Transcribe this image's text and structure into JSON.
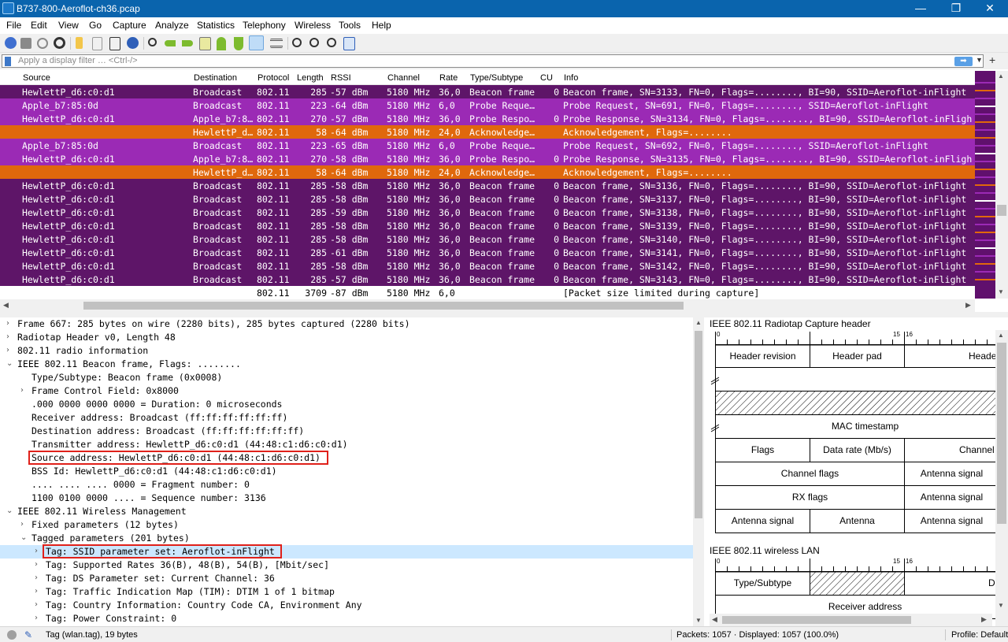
{
  "window": {
    "title": "B737-800-Aeroflot-ch36.pcap",
    "min": "—",
    "restore": "❐",
    "close": "✕"
  },
  "menu": [
    "File",
    "Edit",
    "View",
    "Go",
    "Capture",
    "Analyze",
    "Statistics",
    "Telephony",
    "Wireless",
    "Tools",
    "Help"
  ],
  "filter": {
    "placeholder": "Apply a display filter … <Ctrl-/>",
    "apply_icon": "arrow-right-icon",
    "dropdown": "▼",
    "add": "+"
  },
  "packet_list": {
    "columns": [
      "Source",
      "Destination",
      "Protocol",
      "Length",
      "RSSI",
      "Channel",
      "Rate",
      "Type/Subtype",
      "CU",
      "Info"
    ],
    "colors": {
      "beacon": "#5e1568",
      "probe_req": "#9b2ab5",
      "probe_resp": "#9b2ab5",
      "ack": "#e0680c",
      "limited": "#ffffff",
      "limited_text": "#000000"
    },
    "rows": [
      {
        "kind": "beacon",
        "source": "HewlettP_d6:c0:d1",
        "destination": "Broadcast",
        "protocol": "802.11",
        "length": "285",
        "rssi": "-57 dBm",
        "channel": "5180 MHz",
        "rate": "36,0",
        "type": "Beacon frame",
        "cu": "0",
        "info": "Beacon frame, SN=3133, FN=0, Flags=........, BI=90, SSID=Aeroflot-inFlight"
      },
      {
        "kind": "probe_req",
        "source": "Apple_b7:85:0d",
        "destination": "Broadcast",
        "protocol": "802.11",
        "length": "223",
        "rssi": "-64 dBm",
        "channel": "5180 MHz",
        "rate": "6,0",
        "type": "Probe Reque…",
        "cu": "",
        "info": "Probe Request, SN=691, FN=0, Flags=........, SSID=Aeroflot-inFlight"
      },
      {
        "kind": "probe_resp",
        "source": "HewlettP_d6:c0:d1",
        "destination": "Apple_b7:8…",
        "protocol": "802.11",
        "length": "270",
        "rssi": "-57 dBm",
        "channel": "5180 MHz",
        "rate": "36,0",
        "type": "Probe Respo…",
        "cu": "0",
        "info": "Probe Response, SN=3134, FN=0, Flags=........, BI=90, SSID=Aeroflot-inFlight"
      },
      {
        "kind": "ack",
        "source": "",
        "destination": "HewlettP_d…",
        "protocol": "802.11",
        "length": "58",
        "rssi": "-64 dBm",
        "channel": "5180 MHz",
        "rate": "24,0",
        "type": "Acknowledge…",
        "cu": "",
        "info": "Acknowledgement, Flags=........"
      },
      {
        "kind": "probe_req",
        "source": "Apple_b7:85:0d",
        "destination": "Broadcast",
        "protocol": "802.11",
        "length": "223",
        "rssi": "-65 dBm",
        "channel": "5180 MHz",
        "rate": "6,0",
        "type": "Probe Reque…",
        "cu": "",
        "info": "Probe Request, SN=692, FN=0, Flags=........, SSID=Aeroflot-inFlight"
      },
      {
        "kind": "probe_resp",
        "source": "HewlettP_d6:c0:d1",
        "destination": "Apple_b7:8…",
        "protocol": "802.11",
        "length": "270",
        "rssi": "-58 dBm",
        "channel": "5180 MHz",
        "rate": "36,0",
        "type": "Probe Respo…",
        "cu": "0",
        "info": "Probe Response, SN=3135, FN=0, Flags=........, BI=90, SSID=Aeroflot-inFlight"
      },
      {
        "kind": "ack",
        "source": "",
        "destination": "HewlettP_d…",
        "protocol": "802.11",
        "length": "58",
        "rssi": "-64 dBm",
        "channel": "5180 MHz",
        "rate": "24,0",
        "type": "Acknowledge…",
        "cu": "",
        "info": "Acknowledgement, Flags=........"
      },
      {
        "kind": "beacon",
        "source": "HewlettP_d6:c0:d1",
        "destination": "Broadcast",
        "protocol": "802.11",
        "length": "285",
        "rssi": "-58 dBm",
        "channel": "5180 MHz",
        "rate": "36,0",
        "type": "Beacon frame",
        "cu": "0",
        "info": "Beacon frame, SN=3136, FN=0, Flags=........, BI=90, SSID=Aeroflot-inFlight"
      },
      {
        "kind": "beacon",
        "source": "HewlettP_d6:c0:d1",
        "destination": "Broadcast",
        "protocol": "802.11",
        "length": "285",
        "rssi": "-58 dBm",
        "channel": "5180 MHz",
        "rate": "36,0",
        "type": "Beacon frame",
        "cu": "0",
        "info": "Beacon frame, SN=3137, FN=0, Flags=........, BI=90, SSID=Aeroflot-inFlight"
      },
      {
        "kind": "beacon",
        "source": "HewlettP_d6:c0:d1",
        "destination": "Broadcast",
        "protocol": "802.11",
        "length": "285",
        "rssi": "-59 dBm",
        "channel": "5180 MHz",
        "rate": "36,0",
        "type": "Beacon frame",
        "cu": "0",
        "info": "Beacon frame, SN=3138, FN=0, Flags=........, BI=90, SSID=Aeroflot-inFlight"
      },
      {
        "kind": "beacon",
        "source": "HewlettP_d6:c0:d1",
        "destination": "Broadcast",
        "protocol": "802.11",
        "length": "285",
        "rssi": "-58 dBm",
        "channel": "5180 MHz",
        "rate": "36,0",
        "type": "Beacon frame",
        "cu": "0",
        "info": "Beacon frame, SN=3139, FN=0, Flags=........, BI=90, SSID=Aeroflot-inFlight"
      },
      {
        "kind": "beacon",
        "source": "HewlettP_d6:c0:d1",
        "destination": "Broadcast",
        "protocol": "802.11",
        "length": "285",
        "rssi": "-58 dBm",
        "channel": "5180 MHz",
        "rate": "36,0",
        "type": "Beacon frame",
        "cu": "0",
        "info": "Beacon frame, SN=3140, FN=0, Flags=........, BI=90, SSID=Aeroflot-inFlight"
      },
      {
        "kind": "beacon",
        "source": "HewlettP_d6:c0:d1",
        "destination": "Broadcast",
        "protocol": "802.11",
        "length": "285",
        "rssi": "-61 dBm",
        "channel": "5180 MHz",
        "rate": "36,0",
        "type": "Beacon frame",
        "cu": "0",
        "info": "Beacon frame, SN=3141, FN=0, Flags=........, BI=90, SSID=Aeroflot-inFlight"
      },
      {
        "kind": "beacon",
        "source": "HewlettP_d6:c0:d1",
        "destination": "Broadcast",
        "protocol": "802.11",
        "length": "285",
        "rssi": "-58 dBm",
        "channel": "5180 MHz",
        "rate": "36,0",
        "type": "Beacon frame",
        "cu": "0",
        "info": "Beacon frame, SN=3142, FN=0, Flags=........, BI=90, SSID=Aeroflot-inFlight"
      },
      {
        "kind": "beacon",
        "source": "HewlettP_d6:c0:d1",
        "destination": "Broadcast",
        "protocol": "802.11",
        "length": "285",
        "rssi": "-57 dBm",
        "channel": "5180 MHz",
        "rate": "36,0",
        "type": "Beacon frame",
        "cu": "0",
        "info": "Beacon frame, SN=3143, FN=0, Flags=........, BI=90, SSID=Aeroflot-inFlight"
      },
      {
        "kind": "limited",
        "source": "",
        "destination": "",
        "protocol": "802.11",
        "length": "3709",
        "rssi": "-87 dBm",
        "channel": "5180 MHz",
        "rate": "6,0",
        "type": "",
        "cu": "",
        "info": "[Packet size limited during capture]"
      }
    ]
  },
  "details": [
    {
      "indent": 0,
      "arrow": "›",
      "text": "Frame 667: 285 bytes on wire (2280 bits), 285 bytes captured (2280 bits)"
    },
    {
      "indent": 0,
      "arrow": "›",
      "text": "Radiotap Header v0, Length 48"
    },
    {
      "indent": 0,
      "arrow": "›",
      "text": "802.11 radio information"
    },
    {
      "indent": 0,
      "arrow": "⌄",
      "text": "IEEE 802.11 Beacon frame, Flags: ........"
    },
    {
      "indent": 1,
      "arrow": "",
      "text": "Type/Subtype: Beacon frame (0x0008)"
    },
    {
      "indent": 1,
      "arrow": "›",
      "text": "Frame Control Field: 0x8000"
    },
    {
      "indent": 1,
      "arrow": "",
      "text": ".000 0000 0000 0000 = Duration: 0 microseconds"
    },
    {
      "indent": 1,
      "arrow": "",
      "text": "Receiver address: Broadcast (ff:ff:ff:ff:ff:ff)"
    },
    {
      "indent": 1,
      "arrow": "",
      "text": "Destination address: Broadcast (ff:ff:ff:ff:ff:ff)"
    },
    {
      "indent": 1,
      "arrow": "",
      "text": "Transmitter address: HewlettP_d6:c0:d1 (44:48:c1:d6:c0:d1)"
    },
    {
      "indent": 1,
      "arrow": "",
      "text": "Source address: HewlettP_d6:c0:d1 (44:48:c1:d6:c0:d1)",
      "boxed": true
    },
    {
      "indent": 1,
      "arrow": "",
      "text": "BSS Id: HewlettP_d6:c0:d1 (44:48:c1:d6:c0:d1)"
    },
    {
      "indent": 1,
      "arrow": "",
      "text": ".... .... .... 0000 = Fragment number: 0"
    },
    {
      "indent": 1,
      "arrow": "",
      "text": "1100 0100 0000 .... = Sequence number: 3136"
    },
    {
      "indent": 0,
      "arrow": "⌄",
      "text": "IEEE 802.11 Wireless Management"
    },
    {
      "indent": 1,
      "arrow": "›",
      "text": "Fixed parameters (12 bytes)"
    },
    {
      "indent": 1,
      "arrow": "⌄",
      "text": "Tagged parameters (201 bytes)"
    },
    {
      "indent": 2,
      "arrow": "›",
      "text": "Tag: SSID parameter set: Aeroflot-inFlight",
      "boxed": true,
      "selected": true
    },
    {
      "indent": 2,
      "arrow": "›",
      "text": "Tag: Supported Rates 36(B), 48(B), 54(B), [Mbit/sec]"
    },
    {
      "indent": 2,
      "arrow": "›",
      "text": "Tag: DS Parameter set: Current Channel: 36"
    },
    {
      "indent": 2,
      "arrow": "›",
      "text": "Tag: Traffic Indication Map (TIM): DTIM 1 of 1 bitmap"
    },
    {
      "indent": 2,
      "arrow": "›",
      "text": "Tag: Country Information: Country Code CA, Environment Any"
    },
    {
      "indent": 2,
      "arrow": "›",
      "text": "Tag: Power Constraint: 0"
    }
  ],
  "diagram": {
    "radiotap_title": "IEEE 802.11 Radiotap Capture header",
    "wlan_title": "IEEE 802.11 wireless LAN",
    "ruler": {
      "zero": "0",
      "fifteen": "15",
      "sixteen": "16"
    },
    "fields": {
      "header_revision": "Header revision",
      "header_pad": "Header pad",
      "header_len": "Heade",
      "mac_timestamp": "MAC timestamp",
      "flags": "Flags",
      "data_rate": "Data rate (Mb/s)",
      "channel": "Channel",
      "channel_flags": "Channel flags",
      "antenna_signal_1": "Antenna signal",
      "rx_flags": "RX flags",
      "antenna_signal_2": "Antenna signal",
      "antenna_signal_3": "Antenna signal",
      "antenna": "Antenna",
      "antenna_signal_4": "Antenna signal",
      "type_subtype": "Type/Subtype",
      "duration": "Dur",
      "receiver_address": "Receiver address"
    }
  },
  "status": {
    "left": "Tag (wlan.tag), 19 bytes",
    "packets": "Packets: 1057 · Displayed: 1057 (100.0%)",
    "profile": "Profile: Default"
  }
}
